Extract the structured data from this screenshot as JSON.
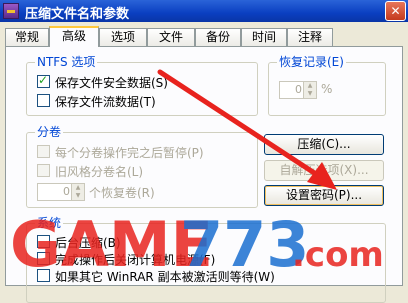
{
  "window": {
    "title": "压缩文件名和参数",
    "close_glyph": "✕"
  },
  "tabs": [
    "常规",
    "高级",
    "选项",
    "文件",
    "备份",
    "时间",
    "注释"
  ],
  "ntfs": {
    "title": "NTFS 选项",
    "save_security": {
      "label": "保存文件安全数据(S)",
      "checked": true
    },
    "save_streams": {
      "label": "保存文件流数据(T)",
      "checked": false
    }
  },
  "recovery": {
    "title": "恢复记录(E)",
    "value": "0",
    "unit": "%"
  },
  "volumes": {
    "title": "分卷",
    "pause": {
      "label": "每个分卷操作完之后暂停(P)",
      "checked": false
    },
    "old_style": {
      "label": "旧风格分卷名(L)",
      "checked": false
    },
    "recovery_volumes_value": "0",
    "recovery_volumes_label": "个恢复卷(R)"
  },
  "buttons": {
    "compression": "压缩(C)...",
    "sfx_options": "自解压选项(X)...",
    "set_password": "设置密码(P)..."
  },
  "system": {
    "title": "系统",
    "opt1": "后台压缩(B)",
    "opt2": "完成操作后关闭计算机电源(F)",
    "opt3": "如果其它 WinRAR 副本被激活则等待(W)"
  },
  "watermark": {
    "text": "GAME773.com",
    "colors": {
      "red": "#e8231e",
      "blue": "#1a6fd0"
    }
  },
  "colors": {
    "accent_arrow": "#e8231e",
    "group_title": "#0046d5",
    "tab_highlight": "#ffc83c"
  }
}
